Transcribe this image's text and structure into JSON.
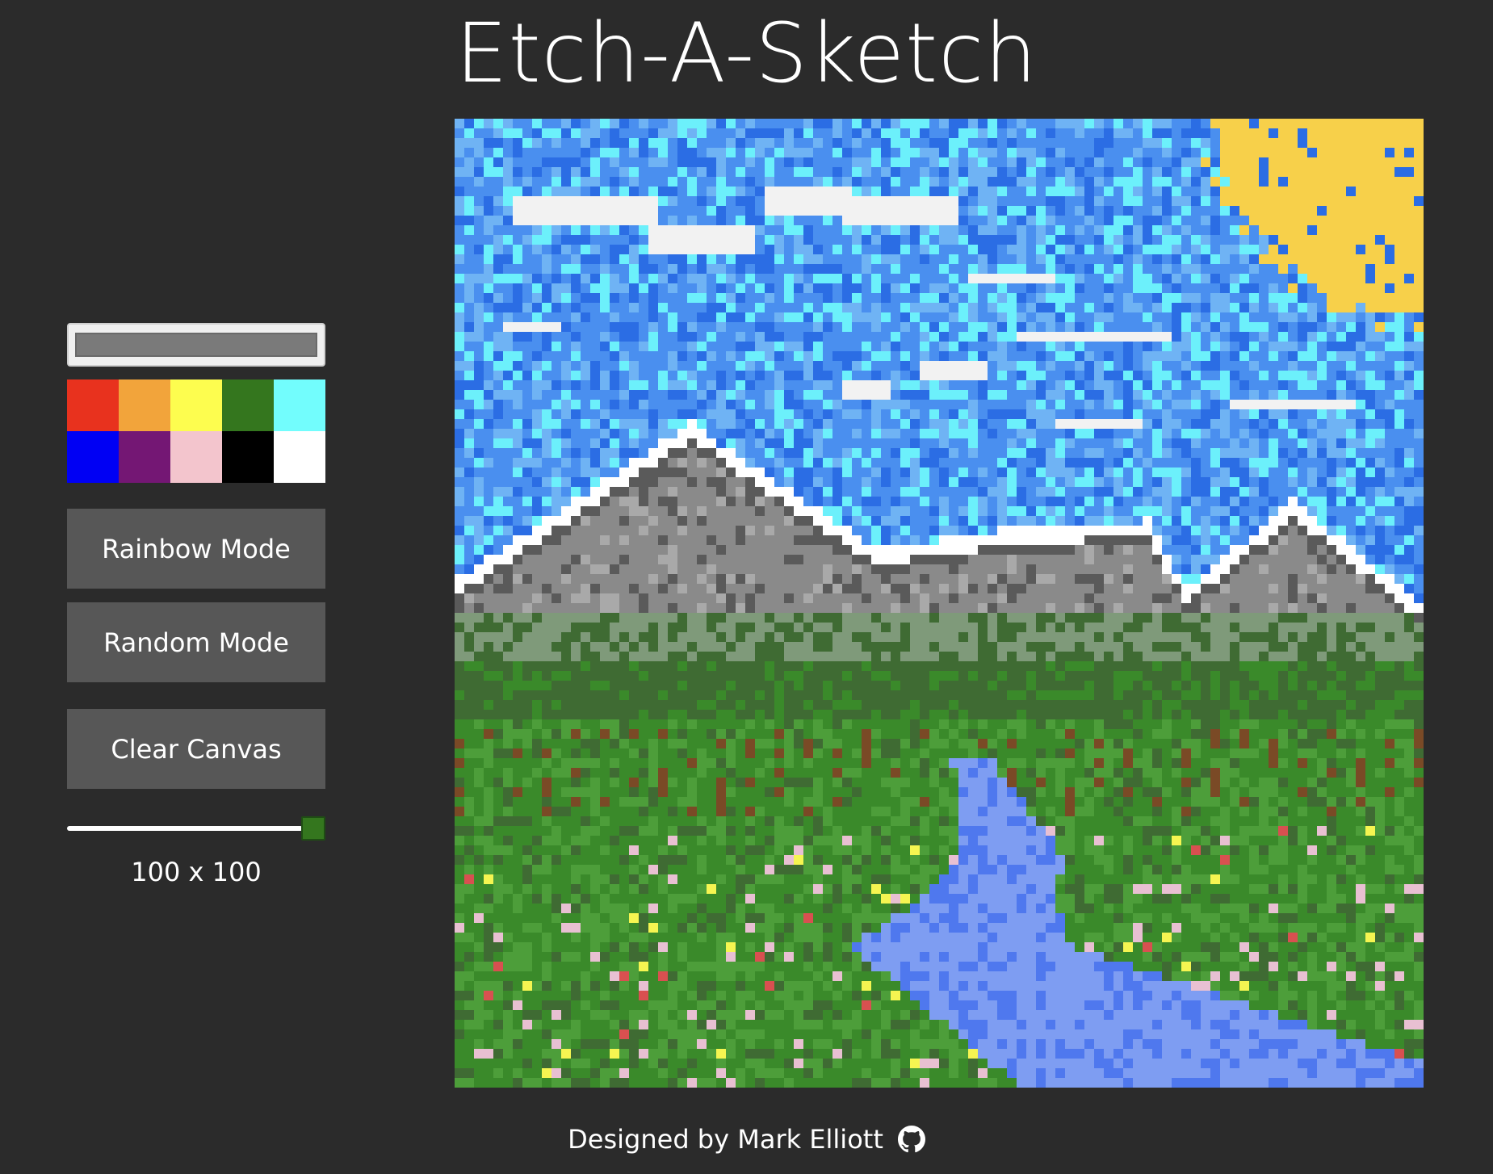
{
  "title": "Etch-A-Sketch",
  "controls": {
    "picker_color": "#7a7a7a",
    "palette": [
      {
        "name": "red",
        "color": "#e8321e"
      },
      {
        "name": "orange",
        "color": "#f2a43b"
      },
      {
        "name": "yellow",
        "color": "#fdfd4f"
      },
      {
        "name": "green",
        "color": "#34761e"
      },
      {
        "name": "cyan",
        "color": "#72fdfd"
      },
      {
        "name": "blue",
        "color": "#0000f4"
      },
      {
        "name": "purple",
        "color": "#741774"
      },
      {
        "name": "pink",
        "color": "#f3c5cd"
      },
      {
        "name": "black",
        "color": "#000000"
      },
      {
        "name": "white",
        "color": "#ffffff"
      }
    ],
    "rainbow_label": "Rainbow Mode",
    "random_label": "Random Mode",
    "clear_label": "Clear Canvas",
    "slider": {
      "value": 100,
      "max": 100,
      "fraction": 1.0,
      "thumb_color": "#34761e"
    },
    "grid_size_label": "100 x 100"
  },
  "canvas": {
    "grid": 100,
    "colors": {
      "sky_blue": "#4a8fef",
      "sky_light": "#6fb3f4",
      "sky_cyan": "#6cf0fb",
      "sky_deep": "#2b6de4",
      "cloud": "#f2f2f2",
      "sun": "#f7d04a",
      "mountain": "#8a8a8a",
      "mountain_dark": "#5a5a5a",
      "mountain_light": "#a9a9a9",
      "snow": "#ffffff",
      "haze": "#7f9a7a",
      "grass_dark": "#3f6b33",
      "grass": "#3a8a2a",
      "grass_light": "#4d9e3a",
      "trunk": "#7a4a26",
      "river": "#7e9df2",
      "river_dark": "#4f78ee",
      "flower_pink": "#e8c0d2",
      "flower_yellow": "#f5f551",
      "flower_red": "#d85050"
    }
  },
  "footer": {
    "text": "Designed by Mark Elliott",
    "icon": "github-icon"
  }
}
